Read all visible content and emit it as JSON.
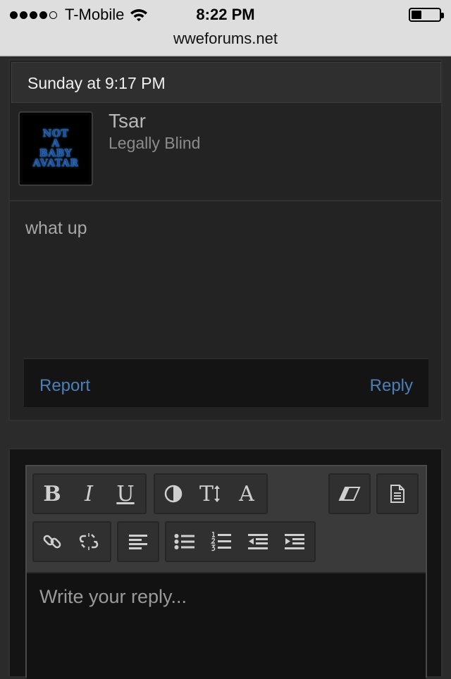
{
  "status_bar": {
    "carrier": "T-Mobile",
    "time": "8:22 PM",
    "signal_bars": 4,
    "signal_total": 5,
    "battery_level": 0.3,
    "url": "wweforums.net"
  },
  "post": {
    "date": "Sunday at 9:17 PM",
    "username": "Tsar",
    "user_title": "Legally Blind",
    "avatar_lines": [
      "NOT",
      "A",
      "BABY",
      "AVATAR"
    ],
    "message": "what up",
    "report_label": "Report",
    "reply_label": "Reply"
  },
  "editor": {
    "toolbar": {
      "bold": "B",
      "italic": "I",
      "underline": "U",
      "font_size": "T",
      "font_family": "A",
      "icons": [
        "bold-icon",
        "italic-icon",
        "underline-icon",
        "color-icon",
        "font-size-icon",
        "font-family-icon",
        "eraser-icon",
        "document-icon",
        "link-icon",
        "unlink-icon",
        "align-left-icon",
        "bullet-list-icon",
        "numbered-list-icon",
        "outdent-icon",
        "indent-icon"
      ]
    },
    "placeholder": "Write your reply..."
  },
  "colors": {
    "link": "#4a7fb8",
    "background": "#2b2b2b",
    "card": "#232323"
  }
}
